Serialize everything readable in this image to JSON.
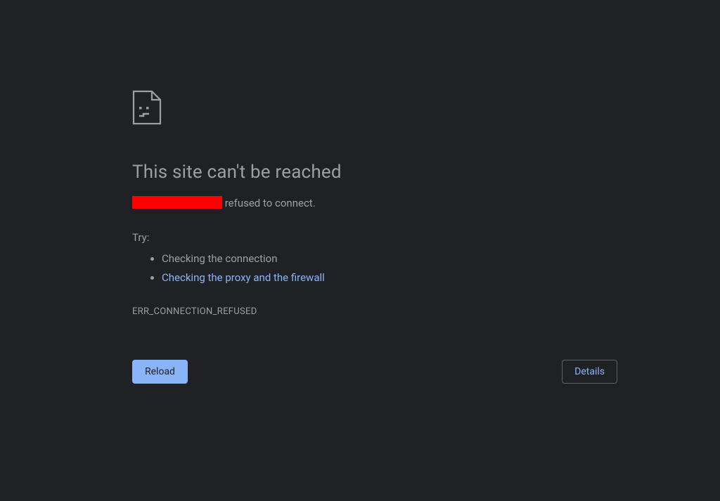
{
  "heading": "This site can't be reached",
  "message_suffix": " refused to connect.",
  "try_label": "Try:",
  "suggestions": {
    "check_connection": "Checking the connection",
    "check_proxy": "Checking the proxy and the firewall"
  },
  "error_code": "ERR_CONNECTION_REFUSED",
  "buttons": {
    "reload": "Reload",
    "details": "Details"
  },
  "icons": {
    "sad_page": "sad-page-icon"
  }
}
